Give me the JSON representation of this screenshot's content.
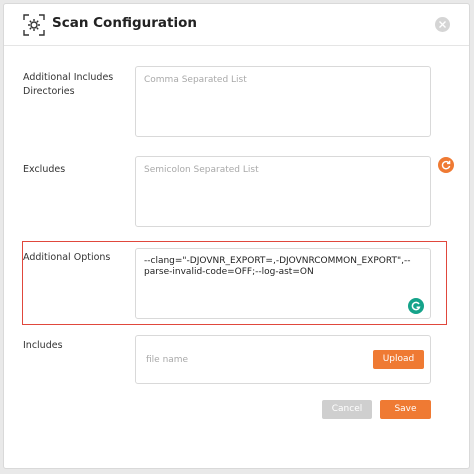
{
  "dialog": {
    "title": "Scan Configuration",
    "icons": {
      "header": "scan-settings-icon",
      "close": "close-icon"
    }
  },
  "fields": {
    "additional_includes": {
      "label": "Additional Includes Directories",
      "placeholder": "Comma Separated List",
      "value": ""
    },
    "excludes": {
      "label": "Excludes",
      "placeholder": "Semicolon Separated List",
      "value": "",
      "icon": "refresh-icon"
    },
    "additional_options": {
      "label": "Additional Options",
      "value": "--clang=\"-DJOVNR_EXPORT=,-DJOVNRCOMMON_EXPORT\",--parse-invalid-code=OFF;--log-ast=ON",
      "assistant_icon": "grammarly-icon"
    },
    "includes": {
      "label": "Includes",
      "file_placeholder": "file name",
      "upload_label": "Upload"
    }
  },
  "actions": {
    "cancel_label": "Cancel",
    "save_label": "Save"
  },
  "colors": {
    "accent": "#ef7a33",
    "highlight": "#e0473c",
    "disabled": "#cfcfcf",
    "grammarly": "#15a38a"
  }
}
